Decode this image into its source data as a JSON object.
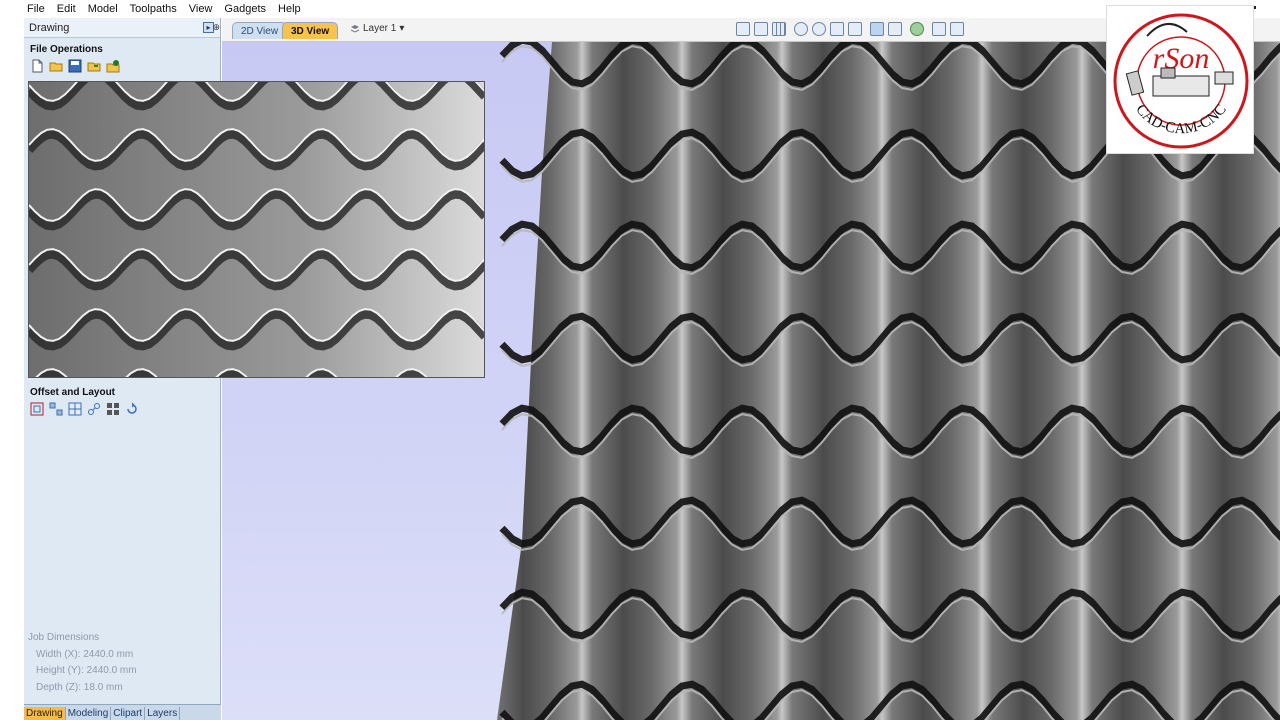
{
  "menu": [
    "File",
    "Edit",
    "Model",
    "Toolpaths",
    "View",
    "Gadgets",
    "Help"
  ],
  "panel": {
    "title": "Drawing",
    "file_operations_title": "File Operations",
    "file_icons": [
      "new-file-icon",
      "open-folder-icon",
      "save-icon",
      "import-folder-icon",
      "export-icon"
    ],
    "offset_layout_title": "Offset and Layout",
    "offset_icons": [
      "offset-icon",
      "array-copy-icon",
      "nest-icon",
      "weld-icon",
      "grid-array-icon",
      "rotate-copy-icon"
    ],
    "job_dimensions": {
      "title": "Job Dimensions",
      "width": "Width  (X): 2440.0 mm",
      "height": "Height (Y): 2440.0 mm",
      "depth": "Depth  (Z): 18.0 mm"
    },
    "bottom_tabs": [
      "Drawing",
      "Modeling",
      "Clipart",
      "Layers"
    ],
    "active_tab": "Drawing"
  },
  "viewbar": {
    "tab_2d": "2D View",
    "tab_3d": "3D View",
    "active_view": "3D View",
    "layer": "Layer 1"
  },
  "logo": {
    "name": "rSon",
    "subtitle": "CAD-CAM-CNC"
  },
  "colors": {
    "panel_bg": "#dfe9f4",
    "viewport_bg": "#c9cbf5",
    "active_tab": "#f8c24e",
    "logo_red": "#d0161d"
  }
}
